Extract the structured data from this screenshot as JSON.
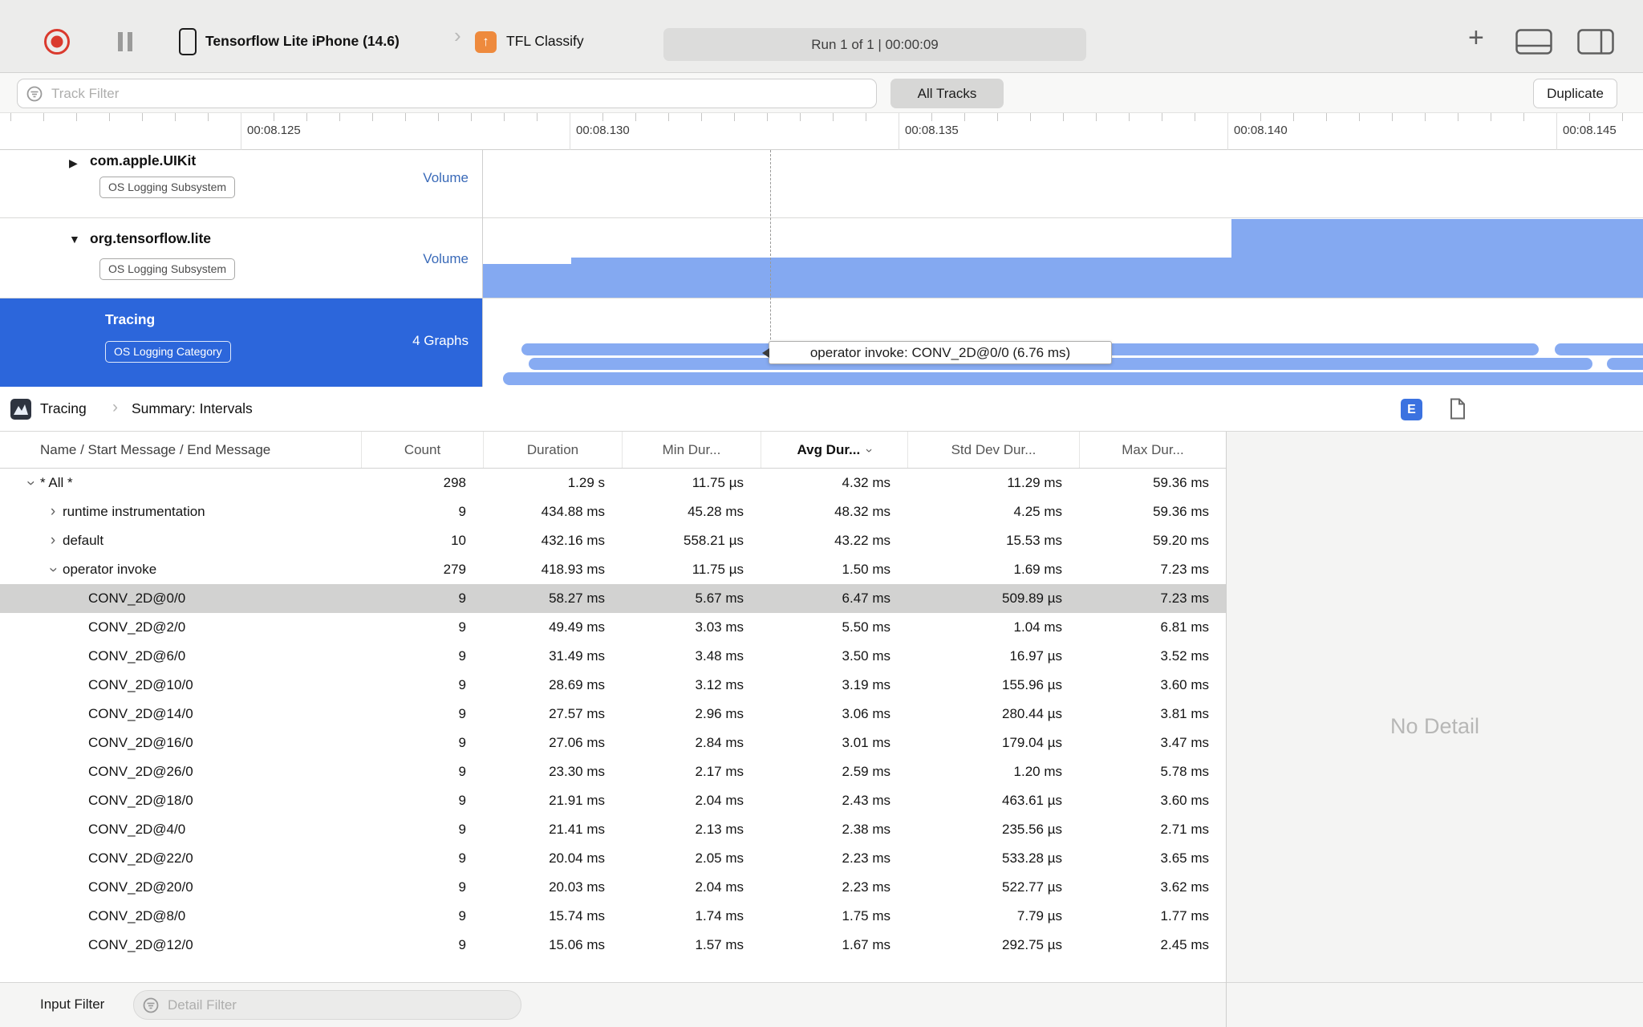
{
  "toolbar": {
    "device_name": "Tensorflow Lite iPhone (14.6)",
    "target_name": "TFL Classify",
    "run_status": "Run 1 of 1  |  00:00:09",
    "plus_label": "+"
  },
  "filter_bar": {
    "track_filter_placeholder": "Track Filter",
    "all_tracks_label": "All Tracks",
    "duplicate_label": "Duplicate"
  },
  "ruler": {
    "labels": [
      "00:08.125",
      "00:08.130",
      "00:08.135",
      "00:08.140",
      "00:08.145"
    ]
  },
  "tracks": [
    {
      "name": "com.apple.UIKit",
      "badge": "OS Logging Subsystem",
      "value_label": "Volume",
      "expanded": false,
      "selected": false
    },
    {
      "name": "org.tensorflow.lite",
      "badge": "OS Logging Subsystem",
      "value_label": "Volume",
      "expanded": true,
      "selected": false
    },
    {
      "name": "Tracing",
      "badge": "OS Logging Category",
      "value_label": "4 Graphs",
      "expanded": false,
      "selected": true
    }
  ],
  "timeline": {
    "tooltip": "operator invoke: CONV_2D@0/0 (6.76 ms)"
  },
  "detail": {
    "breadcrumb": [
      "Tracing",
      "Summary: Intervals"
    ],
    "view_toggle_label": "E",
    "no_detail": "No Detail",
    "table": {
      "columns": [
        "Name / Start Message / End Message",
        "Count",
        "Duration",
        "Min Dur...",
        "Avg Dur...",
        "Std Dev Dur...",
        "Max Dur..."
      ],
      "sorted_column_index": 4,
      "rows": [
        {
          "name": "* All *",
          "level": 0,
          "expand": "open",
          "selected": false,
          "count": "298",
          "duration": "1.29 s",
          "min": "11.75 µs",
          "avg": "4.32 ms",
          "std": "11.29 ms",
          "max": "59.36 ms"
        },
        {
          "name": "runtime instrumentation",
          "level": 1,
          "expand": "closed",
          "selected": false,
          "count": "9",
          "duration": "434.88 ms",
          "min": "45.28 ms",
          "avg": "48.32 ms",
          "std": "4.25 ms",
          "max": "59.36 ms"
        },
        {
          "name": "default",
          "level": 1,
          "expand": "closed",
          "selected": false,
          "count": "10",
          "duration": "432.16 ms",
          "min": "558.21 µs",
          "avg": "43.22 ms",
          "std": "15.53 ms",
          "max": "59.20 ms"
        },
        {
          "name": "operator invoke",
          "level": 1,
          "expand": "open",
          "selected": false,
          "count": "279",
          "duration": "418.93 ms",
          "min": "11.75 µs",
          "avg": "1.50 ms",
          "std": "1.69 ms",
          "max": "7.23 ms"
        },
        {
          "name": "CONV_2D@0/0",
          "level": 2,
          "expand": null,
          "selected": true,
          "count": "9",
          "duration": "58.27 ms",
          "min": "5.67 ms",
          "avg": "6.47 ms",
          "std": "509.89 µs",
          "max": "7.23 ms"
        },
        {
          "name": "CONV_2D@2/0",
          "level": 2,
          "expand": null,
          "selected": false,
          "count": "9",
          "duration": "49.49 ms",
          "min": "3.03 ms",
          "avg": "5.50 ms",
          "std": "1.04 ms",
          "max": "6.81 ms"
        },
        {
          "name": "CONV_2D@6/0",
          "level": 2,
          "expand": null,
          "selected": false,
          "count": "9",
          "duration": "31.49 ms",
          "min": "3.48 ms",
          "avg": "3.50 ms",
          "std": "16.97 µs",
          "max": "3.52 ms"
        },
        {
          "name": "CONV_2D@10/0",
          "level": 2,
          "expand": null,
          "selected": false,
          "count": "9",
          "duration": "28.69 ms",
          "min": "3.12 ms",
          "avg": "3.19 ms",
          "std": "155.96 µs",
          "max": "3.60 ms"
        },
        {
          "name": "CONV_2D@14/0",
          "level": 2,
          "expand": null,
          "selected": false,
          "count": "9",
          "duration": "27.57 ms",
          "min": "2.96 ms",
          "avg": "3.06 ms",
          "std": "280.44 µs",
          "max": "3.81 ms"
        },
        {
          "name": "CONV_2D@16/0",
          "level": 2,
          "expand": null,
          "selected": false,
          "count": "9",
          "duration": "27.06 ms",
          "min": "2.84 ms",
          "avg": "3.01 ms",
          "std": "179.04 µs",
          "max": "3.47 ms"
        },
        {
          "name": "CONV_2D@26/0",
          "level": 2,
          "expand": null,
          "selected": false,
          "count": "9",
          "duration": "23.30 ms",
          "min": "2.17 ms",
          "avg": "2.59 ms",
          "std": "1.20 ms",
          "max": "5.78 ms"
        },
        {
          "name": "CONV_2D@18/0",
          "level": 2,
          "expand": null,
          "selected": false,
          "count": "9",
          "duration": "21.91 ms",
          "min": "2.04 ms",
          "avg": "2.43 ms",
          "std": "463.61 µs",
          "max": "3.60 ms"
        },
        {
          "name": "CONV_2D@4/0",
          "level": 2,
          "expand": null,
          "selected": false,
          "count": "9",
          "duration": "21.41 ms",
          "min": "2.13 ms",
          "avg": "2.38 ms",
          "std": "235.56 µs",
          "max": "2.71 ms"
        },
        {
          "name": "CONV_2D@22/0",
          "level": 2,
          "expand": null,
          "selected": false,
          "count": "9",
          "duration": "20.04 ms",
          "min": "2.05 ms",
          "avg": "2.23 ms",
          "std": "533.28 µs",
          "max": "3.65 ms"
        },
        {
          "name": "CONV_2D@20/0",
          "level": 2,
          "expand": null,
          "selected": false,
          "count": "9",
          "duration": "20.03 ms",
          "min": "2.04 ms",
          "avg": "2.23 ms",
          "std": "522.77 µs",
          "max": "3.62 ms"
        },
        {
          "name": "CONV_2D@8/0",
          "level": 2,
          "expand": null,
          "selected": false,
          "count": "9",
          "duration": "15.74 ms",
          "min": "1.74 ms",
          "avg": "1.75 ms",
          "std": "7.79 µs",
          "max": "1.77 ms"
        },
        {
          "name": "CONV_2D@12/0",
          "level": 2,
          "expand": null,
          "selected": false,
          "count": "9",
          "duration": "15.06 ms",
          "min": "1.57 ms",
          "avg": "1.67 ms",
          "std": "292.75 µs",
          "max": "2.45 ms"
        }
      ]
    }
  },
  "bottom_bar": {
    "input_filter_label": "Input Filter",
    "detail_filter_placeholder": "Detail Filter"
  },
  "colors": {
    "selection_blue": "#2c66db",
    "graph_blue": "#87abf2",
    "record_red": "#da3a2e",
    "volume_label_blue": "#3a6ab8",
    "selected_row_gray": "#d2d2d1",
    "view_toggle_blue": "#3b72e0",
    "target_icon_orange": "#ee8a3d"
  },
  "icons": {
    "record": "record-icon",
    "pause": "pause-icon",
    "device": "iphone-icon",
    "filter": "filter-icon",
    "add": "plus-icon",
    "panes": [
      "toggle-bottom-pane-icon",
      "toggle-right-pane-icon"
    ],
    "document": "document-icon",
    "tracing": "tracing-app-icon"
  }
}
